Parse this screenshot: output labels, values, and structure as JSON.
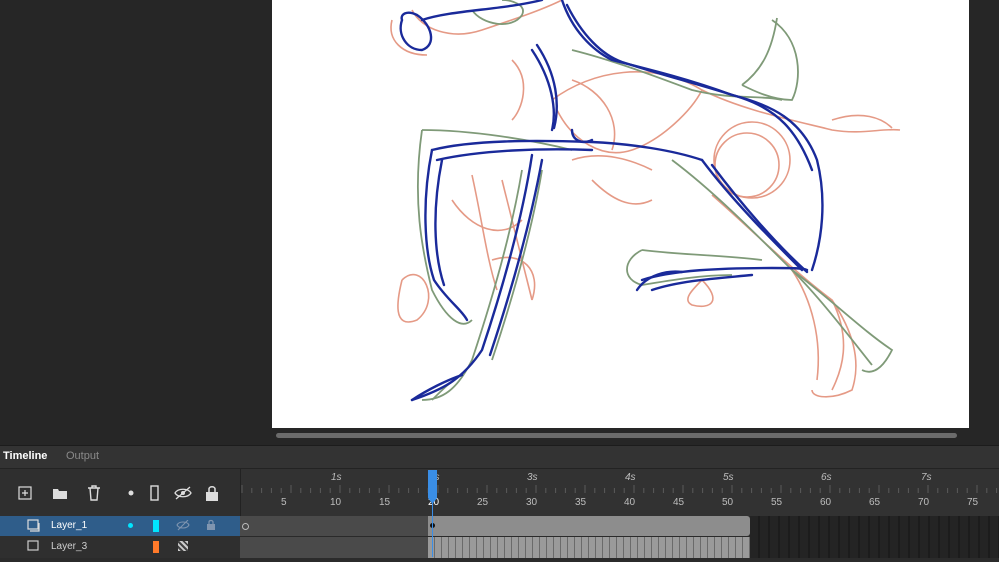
{
  "panel": {
    "tabs": [
      {
        "label": "Timeline",
        "active": true
      },
      {
        "label": "Output",
        "active": false
      }
    ]
  },
  "toolbar": {
    "icons": [
      "add-layer-icon",
      "folder-icon",
      "trash-icon",
      "dot-icon",
      "outline-icon",
      "eye-off-icon",
      "lock-icon"
    ]
  },
  "ruler": {
    "seconds": [
      "1s",
      "2s",
      "3s",
      "4s",
      "5s",
      "6s",
      "7s"
    ],
    "frame_numbers": [
      "5",
      "10",
      "15",
      "20",
      "25",
      "30",
      "35",
      "40",
      "45",
      "50",
      "55",
      "60",
      "65",
      "70",
      "75"
    ],
    "current_frame": "20"
  },
  "layers": [
    {
      "name": "Layer_1",
      "selected": true,
      "color": "#00e5ff"
    },
    {
      "name": "Layer_3",
      "selected": false,
      "color": "#ff7a2a"
    }
  ],
  "colors": {
    "sketch_navy": "#1a2a9a",
    "sketch_salmon": "#e59a86",
    "sketch_green": "#7f9a78",
    "accent": "#3a8ee6"
  }
}
